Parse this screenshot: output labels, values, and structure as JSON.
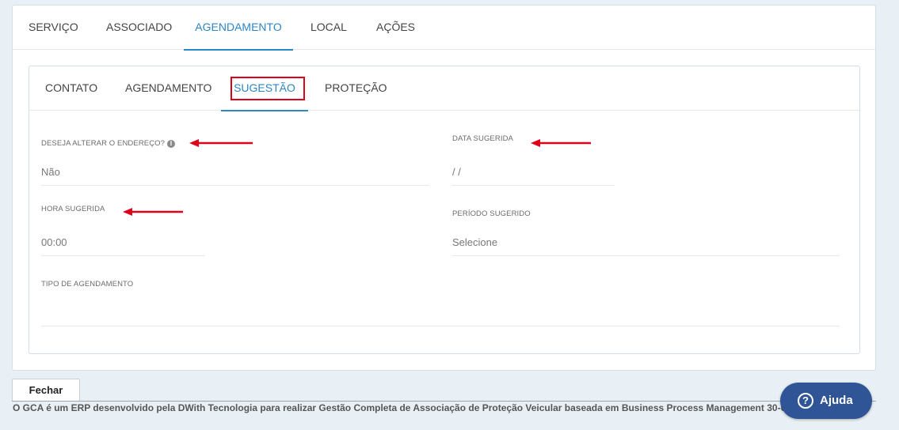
{
  "top_tabs": [
    {
      "label": "SERVIÇO",
      "active": false
    },
    {
      "label": "ASSOCIADO",
      "active": false
    },
    {
      "label": "AGENDAMENTO",
      "active": true
    },
    {
      "label": "LOCAL",
      "active": false
    },
    {
      "label": "AÇÕES",
      "active": false
    }
  ],
  "inner_tabs": [
    {
      "label": "CONTATO",
      "active": false
    },
    {
      "label": "AGENDAMENTO",
      "active": false
    },
    {
      "label": "SUGESTÃO",
      "active": true
    },
    {
      "label": "PROTEÇÃO",
      "active": false
    }
  ],
  "fields": {
    "alterar_endereco": {
      "label": "DESEJA ALTERAR O ENDEREÇO?",
      "value": "Não"
    },
    "data_sugerida": {
      "label": "DATA SUGERIDA",
      "value": "/ /"
    },
    "hora_sugerida": {
      "label": "HORA SUGERIDA",
      "value": "00:00"
    },
    "periodo_sugerido": {
      "label": "PERÍODO SUGERIDO",
      "value": "Selecione"
    },
    "tipo_agendamento": {
      "label": "TIPO DE AGENDAMENTO",
      "value": ""
    }
  },
  "buttons": {
    "fechar": "Fechar",
    "ajuda": "Ajuda"
  },
  "footer": {
    "text": "O GCA é um ERP desenvolvido pela DWith Tecnologia para realizar Gestão Completa de Associação de Proteção Veicular baseada em Business Process Management 30-08-2024 - Build 230"
  },
  "colors": {
    "accent": "#2b86c5",
    "highlight": "#e0001a",
    "help_button": "#2f5597"
  },
  "icons": {
    "info": "info-icon",
    "help": "question-circle-icon",
    "annotation": "red-arrow-icon"
  }
}
